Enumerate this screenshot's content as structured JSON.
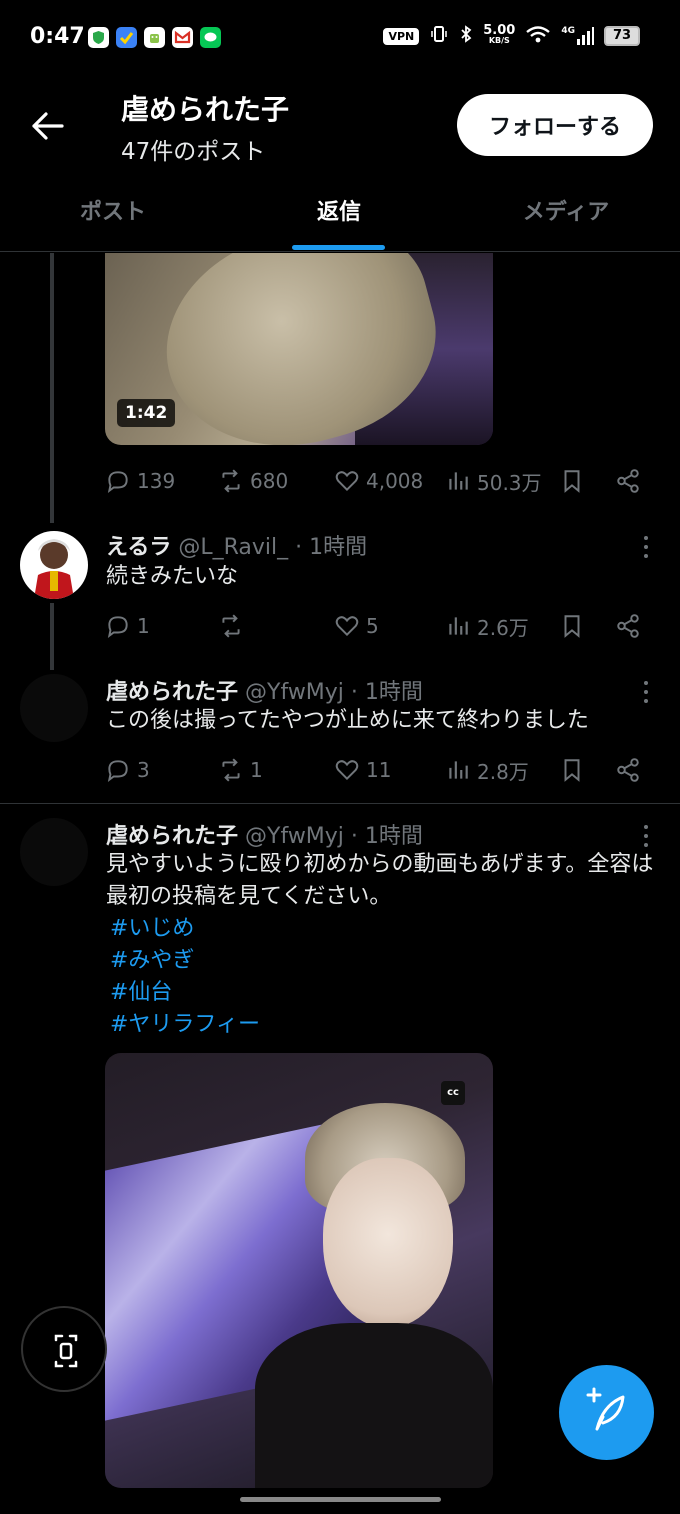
{
  "status_bar": {
    "time": "0:47",
    "vpn": "VPN",
    "speed_value": "5.00",
    "speed_unit": "KB/S",
    "network": "4G",
    "battery": "73"
  },
  "header": {
    "title": "虐められた子",
    "subtitle": "47件のポスト",
    "follow_label": "フォローする"
  },
  "tabs": [
    {
      "label": "ポスト",
      "active": false
    },
    {
      "label": "返信",
      "active": true
    },
    {
      "label": "メディア",
      "active": false
    }
  ],
  "video1": {
    "duration": "1:42"
  },
  "tweet0_actions": {
    "replies": "139",
    "reposts": "680",
    "likes": "4,008",
    "views": "50.3万"
  },
  "tweets": [
    {
      "name": "えるラ",
      "handle": "@L_Ravil_",
      "time": "1時間",
      "text": "続きみたいな",
      "replies": "1",
      "reposts": "",
      "likes": "5",
      "views": "2.6万"
    },
    {
      "name": "虐められた子",
      "handle": "@YfwMyj",
      "time": "1時間",
      "text": "この後は撮ってたやつが止めに来て終わりました",
      "replies": "3",
      "reposts": "1",
      "likes": "11",
      "views": "2.8万"
    },
    {
      "name": "虐められた子",
      "handle": "@YfwMyj",
      "time": "1時間",
      "text": "見やすいように殴り初めからの動画もあげます。全容は最初の投稿を見てください。",
      "hashtags": [
        "#いじめ",
        "#みやぎ",
        "#仙台",
        "#ヤリラフィー"
      ]
    }
  ],
  "video2": {
    "cc_label": "cc"
  },
  "colors": {
    "accent": "#1d9bf0",
    "background": "#000000",
    "muted": "#71767b"
  }
}
